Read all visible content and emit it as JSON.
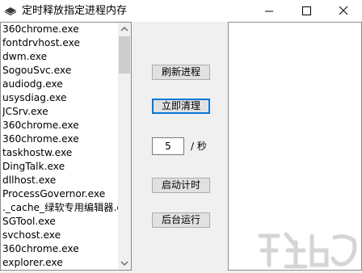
{
  "window": {
    "title": "定时释放指定进程内存",
    "icon": "app-book-icon",
    "controls": [
      "minimize-icon",
      "maximize-icon",
      "close-icon"
    ]
  },
  "process_list": {
    "items": [
      "360chrome.exe",
      "fontdrvhost.exe",
      "dwm.exe",
      "SogouSvc.exe",
      "audiodg.exe",
      "usysdiag.exe",
      "JCSrv.exe",
      "360chrome.exe",
      "360chrome.exe",
      "taskhostw.exe",
      "DingTalk.exe",
      "dllhost.exe",
      "ProcessGovernor.exe",
      "._cache_绿软专用编辑器.exe",
      "SGTool.exe",
      "svchost.exe",
      "360chrome.exe",
      "explorer.exe"
    ]
  },
  "controls": {
    "refresh_label": "刷新进程",
    "clean_label": "立即清理",
    "interval_value": "5",
    "interval_unit": "/ 秒",
    "start_timer_label": "启动计时",
    "background_label": "后台运行"
  },
  "watermark": {
    "icon": "downza-logo-icon"
  }
}
